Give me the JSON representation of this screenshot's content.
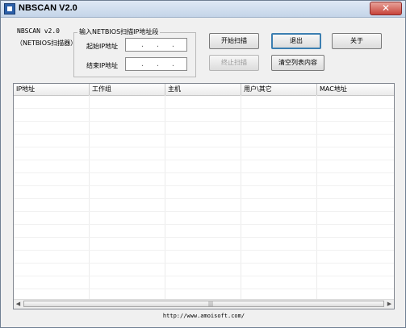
{
  "window": {
    "title": "NBSCAN V2.0",
    "close_label": "✕"
  },
  "app": {
    "name_version": "NBSCAN v2.0",
    "subtitle": "（NETBIOS扫描器）"
  },
  "range": {
    "group_title": "输入NETBIOS扫描IP地址段",
    "start_label": "起始IP地址",
    "end_label": "结束IP地址",
    "dot": "."
  },
  "buttons": {
    "start_scan": "开始扫描",
    "stop_scan": "终止扫描",
    "exit": "退出",
    "clear_list": "清空列表内容",
    "about": "关于"
  },
  "table": {
    "columns": [
      "IP地址",
      "工作组",
      "主机",
      "用户\\其它",
      "MAC地址"
    ],
    "rows": []
  },
  "scrollbar": {
    "left_arrow": "◀",
    "right_arrow": "▶",
    "grip": "|||"
  },
  "footer": {
    "url": "http://www.amoisoft.com/"
  }
}
